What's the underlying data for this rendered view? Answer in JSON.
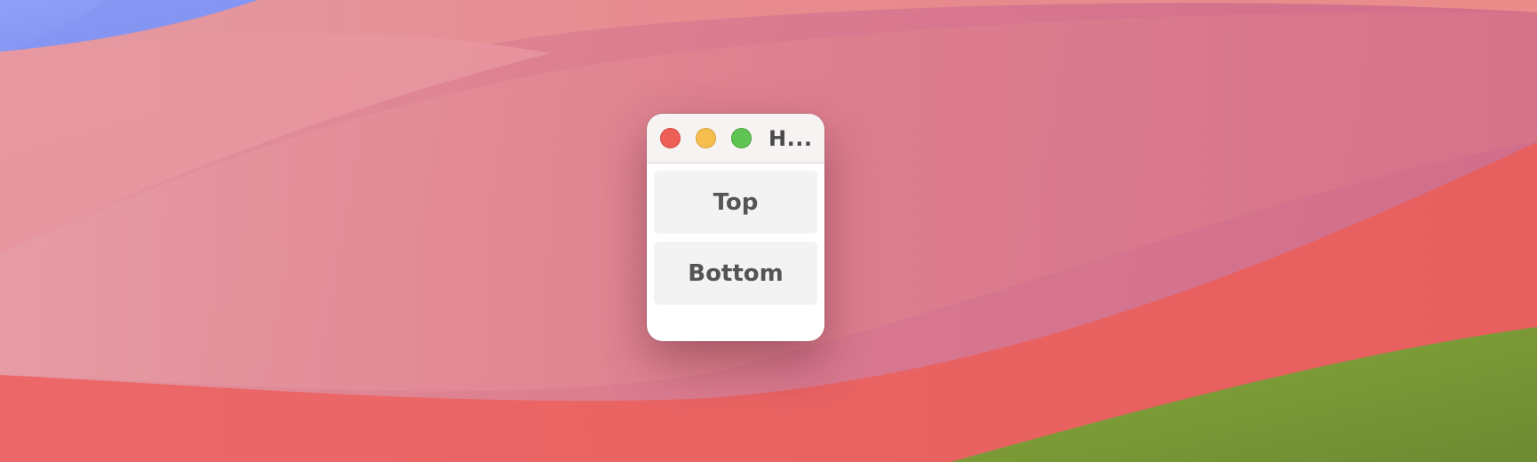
{
  "window": {
    "title": "H..."
  },
  "buttons": {
    "top_label": "Top",
    "bottom_label": "Bottom"
  },
  "colors": {
    "close": "#ee5f57",
    "minimize": "#f6be4f",
    "zoom": "#5fc454",
    "button_bg": "#f3f3f3",
    "button_text": "#555555"
  }
}
